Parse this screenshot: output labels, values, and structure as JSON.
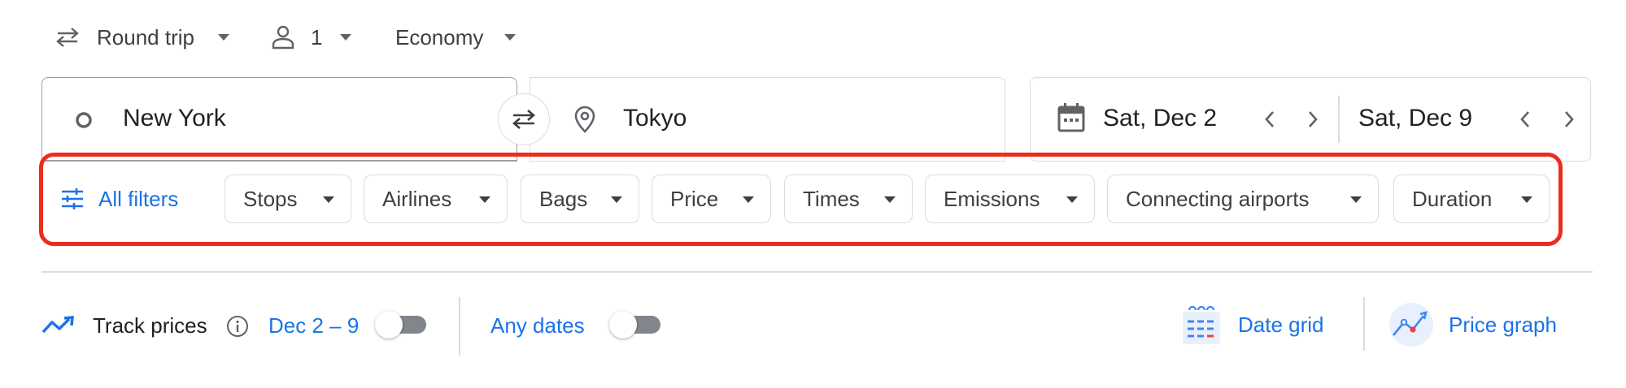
{
  "trip_options": {
    "trip_type": "Round trip",
    "passengers": "1",
    "cabin_class": "Economy"
  },
  "search": {
    "origin": "New York",
    "destination": "Tokyo",
    "depart_date": "Sat, Dec 2",
    "return_date": "Sat, Dec 9"
  },
  "filters": {
    "all_filters": "All filters",
    "chips": [
      "Stops",
      "Airlines",
      "Bags",
      "Price",
      "Times",
      "Emissions",
      "Connecting airports",
      "Duration"
    ]
  },
  "tracking": {
    "track_prices": "Track prices",
    "date_range": "Dec 2 – 9",
    "any_dates": "Any dates",
    "date_grid": "Date grid",
    "price_graph": "Price graph"
  },
  "colors": {
    "accent": "#1a73e8",
    "highlight": "#ea2d1f",
    "border": "#dadce0"
  }
}
